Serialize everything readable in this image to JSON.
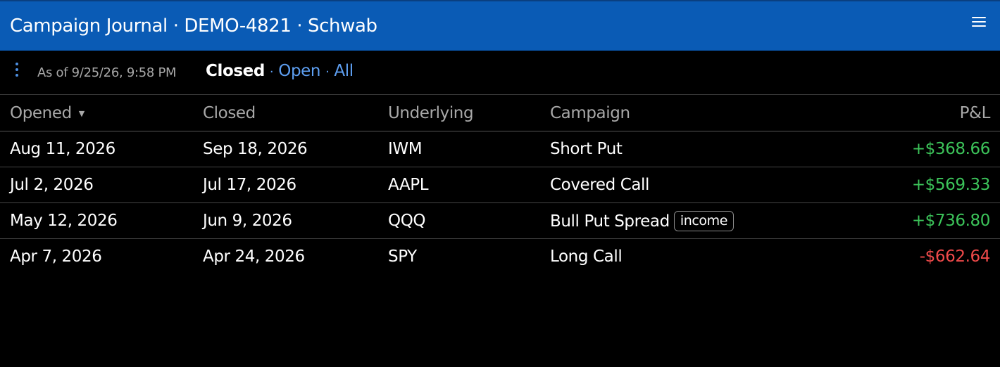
{
  "header": {
    "title": "Campaign Journal · DEMO-4821 · Schwab",
    "menu_icon": "hamburger-menu-icon"
  },
  "toolbar": {
    "more_icon": "kebab-vertical-icon",
    "as_of": "As of 9/25/26, 9:58 PM",
    "filters": {
      "closed": "Closed",
      "open": "Open",
      "all": "All",
      "separator": "·",
      "selected": "Closed"
    }
  },
  "table": {
    "columns": {
      "opened": "Opened",
      "closed": "Closed",
      "underlying": "Underlying",
      "campaign": "Campaign",
      "pnl": "P&L"
    },
    "sort": {
      "column": "Opened",
      "direction": "descending",
      "icon": "sort-down-icon"
    },
    "rows": [
      {
        "opened": "Aug 11, 2026",
        "closed": "Sep 18, 2026",
        "underlying": "IWM",
        "campaign": "Short Put",
        "tag": "",
        "pnl": "+$368.66",
        "pnl_sign": "positive"
      },
      {
        "opened": "Jul 2, 2026",
        "closed": "Jul 17, 2026",
        "underlying": "AAPL",
        "campaign": "Covered Call",
        "tag": "",
        "pnl": "+$569.33",
        "pnl_sign": "positive"
      },
      {
        "opened": "May 12, 2026",
        "closed": "Jun 9, 2026",
        "underlying": "QQQ",
        "campaign": "Bull Put Spread",
        "tag": "income",
        "pnl": "+$736.80",
        "pnl_sign": "positive"
      },
      {
        "opened": "Apr 7, 2026",
        "closed": "Apr 24, 2026",
        "underlying": "SPY",
        "campaign": "Long Call",
        "tag": "",
        "pnl": "-$662.64",
        "pnl_sign": "negative"
      }
    ]
  },
  "colors": {
    "header_bg": "#0a5bb5",
    "background": "#000000",
    "link": "#5d9ef0",
    "positive": "#3cc45a",
    "negative": "#f04a4a",
    "muted": "#a8a8a8"
  }
}
